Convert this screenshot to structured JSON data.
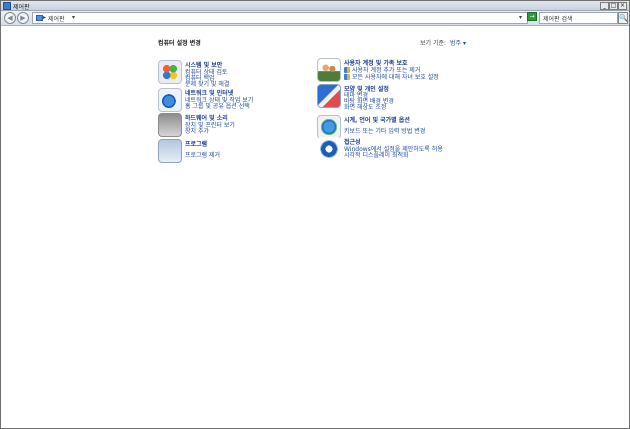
{
  "window": {
    "title": "제어판",
    "min_label": "_",
    "max_label": "□",
    "close_label": "×"
  },
  "toolbar": {
    "back_label": "◀",
    "forward_label": "▶",
    "breadcrumb_arrow": "▸",
    "address": "제어판",
    "address_dropdown": "▾",
    "history_dropdown": "▾",
    "refresh_label": "→",
    "search_placeholder": "제어판 검색",
    "search_go_label": "🔍"
  },
  "main": {
    "heading": "컴퓨터 설정 변경",
    "view_by_label": "보기 기준:",
    "view_by_value": "범주 ▾",
    "categories": [
      {
        "id": "system-security",
        "icon": "system-security-icon",
        "title": "시스템 및 보안",
        "links": [
          "컴퓨터 상태 검토",
          "컴퓨터 백업",
          "문제 찾기 및 해결"
        ]
      },
      {
        "id": "network-internet",
        "icon": "network-internet-icon",
        "title": "네트워크 및 인터넷",
        "links": [
          "네트워크 상태 및 작업 보기",
          "홈 그룹 및 공유 옵션 선택"
        ]
      },
      {
        "id": "hardware-sound",
        "icon": "hardware-sound-icon",
        "title": "하드웨어 및 소리",
        "links": [
          "장치 및 프린터 보기",
          "장치 추가"
        ]
      },
      {
        "id": "programs",
        "icon": "programs-icon",
        "title": "프로그램",
        "links": [
          "프로그램 제거"
        ]
      },
      {
        "id": "user-accounts",
        "icon": "user-accounts-icon",
        "title": "사용자 계정 및 가족 보호",
        "links": [
          "사용자 계정 추가 또는 제거",
          "모든 사용자에 대해 자녀 보호 설정"
        ]
      },
      {
        "id": "appearance",
        "icon": "appearance-icon",
        "title": "모양 및 개인 설정",
        "links": [
          "테마 변경",
          "바탕 화면 배경 변경",
          "화면 해상도 조정"
        ]
      },
      {
        "id": "clock-language",
        "icon": "clock-language-icon",
        "title": "시계, 언어 및 국가별 옵션",
        "links": [
          "키보드 또는 기타 입력 방법 변경"
        ]
      },
      {
        "id": "ease-of-access",
        "icon": "ease-of-access-icon",
        "title": "접근성",
        "links": [
          "Windows에서 설정을 제안하도록 허용",
          "시각적 디스플레이 최적화"
        ]
      }
    ]
  }
}
